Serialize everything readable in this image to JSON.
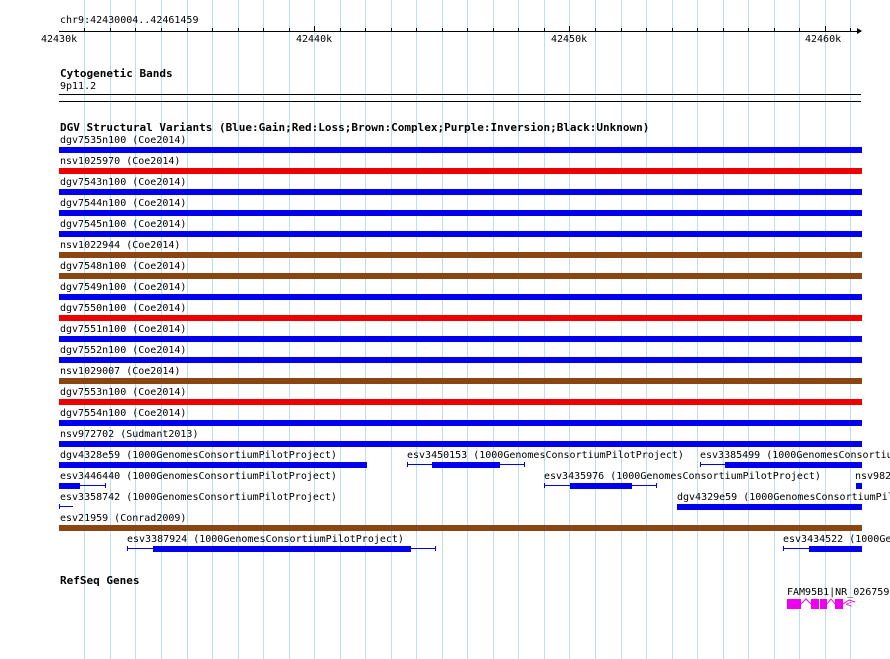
{
  "view": {
    "position_label": "chr9:42430004..42461459",
    "start": 42430004,
    "end": 42461459,
    "ruler_labels": [
      {
        "label": "42430k",
        "pos": 42430000
      },
      {
        "label": "42440k",
        "pos": 42440000
      },
      {
        "label": "42450k",
        "pos": 42450000
      },
      {
        "label": "42460k",
        "pos": 42460000
      }
    ]
  },
  "colors": {
    "gain": "#0000ee",
    "loss": "#ee0000",
    "complex": "#8b4513",
    "gene": "#ee00ee",
    "grid": "#b8e0f0"
  },
  "cytoband": {
    "title": "Cytogenetic Bands",
    "band": "9p11.2"
  },
  "dgv": {
    "title": "DGV Structural Variants (Blue:Gain;Red:Loss;Brown:Complex;Purple:Inversion;Black:Unknown)",
    "rows": [
      {
        "label": "dgv7535n100 (Coe2014)",
        "type": "gain"
      },
      {
        "label": "nsv1025970 (Coe2014)",
        "type": "loss"
      },
      {
        "label": "dgv7543n100 (Coe2014)",
        "type": "gain"
      },
      {
        "label": "dgv7544n100 (Coe2014)",
        "type": "gain"
      },
      {
        "label": "dgv7545n100 (Coe2014)",
        "type": "gain"
      },
      {
        "label": "nsv1022944 (Coe2014)",
        "type": "complex"
      },
      {
        "label": "dgv7548n100 (Coe2014)",
        "type": "complex"
      },
      {
        "label": "dgv7549n100 (Coe2014)",
        "type": "gain"
      },
      {
        "label": "dgv7550n100 (Coe2014)",
        "type": "loss"
      },
      {
        "label": "dgv7551n100 (Coe2014)",
        "type": "gain"
      },
      {
        "label": "dgv7552n100 (Coe2014)",
        "type": "gain"
      },
      {
        "label": "nsv1029007 (Coe2014)",
        "type": "complex"
      },
      {
        "label": "dgv7553n100 (Coe2014)",
        "type": "loss"
      },
      {
        "label": "dgv7554n100 (Coe2014)",
        "type": "gain"
      },
      {
        "label": "nsv972702 (Sudmant2013)",
        "type": "gain"
      }
    ],
    "partial_rows": [
      [
        {
          "label": "dgv4328e59 (1000GenomesConsortiumPilotProject)"
        },
        {
          "label": "esv3450153 (1000GenomesConsortiumPilotProject)"
        },
        {
          "label": "esv3385499 (1000GenomesConsortiu"
        }
      ],
      [
        {
          "label": "esv3446440 (1000GenomesConsortiumPilotProject)"
        },
        {
          "label": "esv3435976 (1000GenomesConsortiumPilotProject)"
        },
        {
          "label": "nsv982"
        }
      ],
      [
        {
          "label": "esv3358742 (1000GenomesConsortiumPilotProject)"
        },
        {
          "label": "dgv4329e59 (1000GenomesConsortiumPil"
        }
      ],
      [
        {
          "label": "esv21959 (Conrad2009)"
        }
      ],
      [
        {
          "label": "esv3387924 (1000GenomesConsortiumPilotProject)"
        },
        {
          "label": "esv3434522 (1000Ge"
        }
      ]
    ]
  },
  "refseq": {
    "title": "RefSeq Genes",
    "gene_label": "FAM95B1|NR_026759"
  }
}
